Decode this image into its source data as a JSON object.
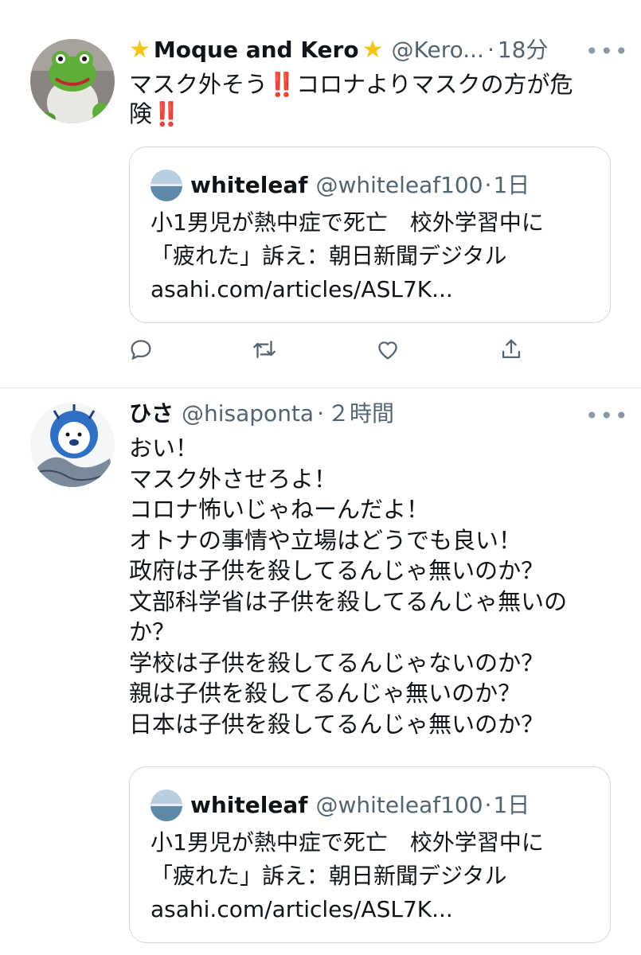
{
  "tweets": [
    {
      "name_prefix_icon": "star-icon",
      "name": "Moque and Kero",
      "name_suffix_icon": "star-icon",
      "handle": "@Kero...",
      "separator": "·",
      "time": "18分",
      "more": "•••",
      "text_lines": [
        {
          "before": "マスク外そう",
          "emoji": "‼️",
          "after": "コロナよりマスクの方が危"
        },
        {
          "before": "険",
          "emoji": "‼️",
          "after": ""
        }
      ],
      "quote": {
        "name": "whiteleaf",
        "handle": "@whiteleaf100",
        "separator": "·",
        "time": "1日",
        "line1": "小1男児が熱中症で死亡　校外学習中に",
        "line2": "「疲れた」訴え：朝日新聞デジタル",
        "line3": "asahi.com/articles/ASL7K..."
      },
      "actions": [
        "reply-icon",
        "retweet-icon",
        "like-icon",
        "share-icon"
      ]
    },
    {
      "name": "ひさ",
      "handle": "@hisaponta",
      "separator": "·",
      "time": "２時間",
      "more": "•••",
      "text_lines": [
        "おい！",
        "マスク外させろよ！",
        "コロナ怖いじゃねーんだよ！",
        "オトナの事情や立場はどうでも良い！",
        "政府は子供を殺してるんじゃ無いのか？",
        "文部科学省は子供を殺してるんじゃ無いの",
        "か？",
        "学校は子供を殺してるんじゃないのか？",
        "親は子供を殺してるんじゃ無いのか？",
        "日本は子供を殺してるんじゃ無いのか？"
      ],
      "quote": {
        "name": "whiteleaf",
        "handle": "@whiteleaf100",
        "separator": "·",
        "time": "1日",
        "line1": "小1男児が熱中症で死亡　校外学習中に",
        "line2": "「疲れた」訴え：朝日新聞デジタル",
        "line3": "asahi.com/articles/ASL7K..."
      }
    }
  ],
  "colors": {
    "text": "#0f1419",
    "secondary": "#536471",
    "border": "#cfd9de",
    "emoji_red": "#e0245e",
    "star": "#f5c518"
  }
}
